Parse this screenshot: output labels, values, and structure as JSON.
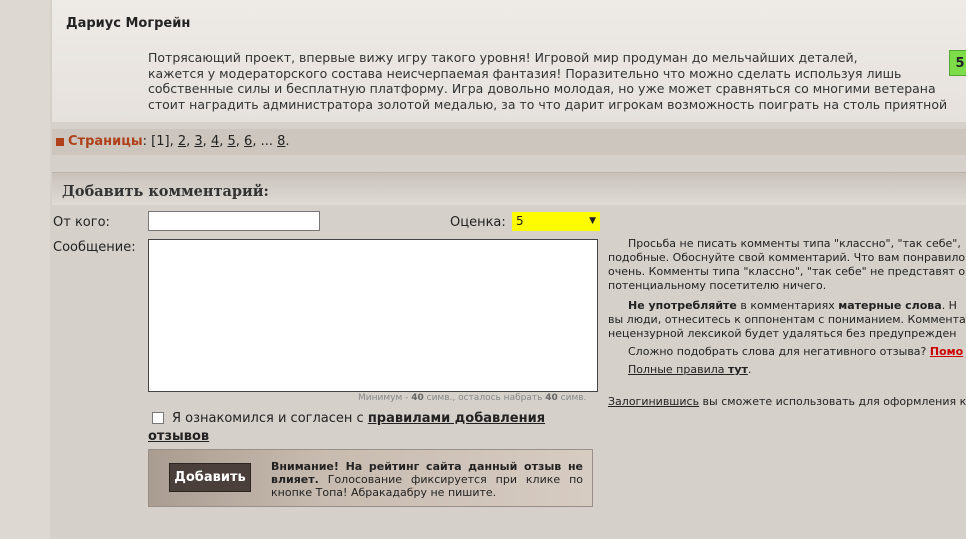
{
  "comment": {
    "author": "Дариус Могрейн",
    "lines": [
      "Потрясающий проект, впервые вижу игру такого уровня! Игровой мир продуман до мельчайших деталей,",
      "кажется у модераторского состава неисчерпаемая фантазия! Поразительно что можно сделать используя лишь",
      "собственные силы и бесплатную платформу. Игра довольно молодая, но уже может сравняться со многими ветерана",
      "стоит наградить администратора золотой медалью, за то что дарит игрокам возможность поиграть на столь приятной"
    ],
    "rating": "5"
  },
  "pagination": {
    "label": "Страницы",
    "current": "[1]",
    "pages": [
      "2",
      "3",
      "4",
      "5",
      "6"
    ],
    "ellipsis": "...",
    "last": "8"
  },
  "form": {
    "title": "Добавить комментарий:",
    "from_label": "От кого:",
    "from_value": "",
    "rating_label": "Оценка:",
    "rating_value": "5",
    "message_label": "Сообщение:",
    "message_value": "",
    "counter_prefix": "Минимум - ",
    "counter_min": "40",
    "counter_mid": " симв., осталось набрать ",
    "counter_left": "40",
    "counter_suffix": " симв.",
    "agree_text": "Я ознакомился и согласен с ",
    "agree_link_part1": "правилами добавления",
    "agree_link_part2": "отзывов",
    "submit_label": "Добавить",
    "notice_bold": "Внимание! На рейтинг сайта данный отзыв не влияет.",
    "notice_text": " Голосование фиксируется при клике по кнопке Топа! Абракадабру не пишите."
  },
  "rules": {
    "p1": [
      "Просьба не писать комменты типа \"классно\", \"так себе\",",
      "подобные. Обоснуйте свой комментарий. Что вам понравило",
      "очень. Комменты типа \"классно\", \"так себе\" не представят о",
      "потенциальному посетителю ничего."
    ],
    "p2_a": "Не употребляйте",
    "p2_b": " в комментариях ",
    "p2_c": "матерные слова",
    "p2_d": ". Н",
    "p2_lines": [
      "вы люди, отнеситесь к оппонентам с пониманием. Комментар",
      "нецензурной лексикой будет удаляться без предупрежден"
    ],
    "p3": "Сложно подобрать слова для негативного отзыва? ",
    "p3_link": "Помо",
    "p4": "Полные правила ",
    "p4_link": "тут",
    "p4_end": ".",
    "p5_link": "Залогинившись",
    "p5": " вы сможете использовать для оформления к"
  },
  "colors": {
    "accent": "#b0401a",
    "highlight": "#fffb00",
    "badge": "#7cdc4a",
    "help_link": "#cc0000"
  }
}
